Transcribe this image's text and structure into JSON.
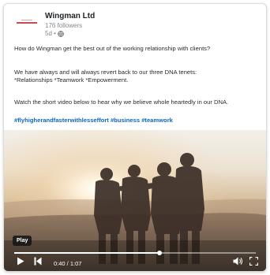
{
  "post": {
    "company_name": "Wingman Ltd",
    "followers": "176 followers",
    "age": "5d •",
    "paragraph1": "How do Wingman get the best out of the working relationship with clients?",
    "paragraph2_line1": "We have always and will always revert back to our three DNA tenets:",
    "paragraph2_line2": "*Relationships *Teamwork *Empowerment.",
    "paragraph3": "Watch the short video below to hear why we believe whole heartedly in our DNA.",
    "hashtags": "#flyhigherandfasterwithlesseffort #business #teamwork"
  },
  "video": {
    "badge": "Play",
    "current_time": "0:40",
    "duration": "1:07",
    "time_display": "0:40 / 1:07",
    "progress_fraction": 0.6
  },
  "icons": {
    "visibility": "globe-icon",
    "play": "play-icon",
    "skip_back": "skip-back-icon",
    "volume": "volume-icon",
    "fullscreen": "fullscreen-icon"
  },
  "colors": {
    "link": "#0a66c2",
    "brand_red": "#c84b4b"
  }
}
